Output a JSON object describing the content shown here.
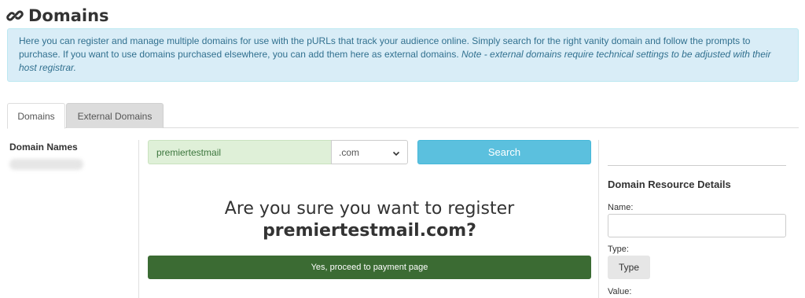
{
  "header": {
    "title": "Domains",
    "icon": "link-icon"
  },
  "info": {
    "text": "Here you can register and manage multiple domains for use with the pURLs that track your audience online. Simply search for the right vanity domain and follow the prompts to purchase. If you want to use domains purchased elsewhere, you can add them here as external domains.",
    "note": "Note - external domains require technical settings to be adjusted with their host registrar."
  },
  "tabs": [
    {
      "label": "Domains",
      "active": true
    },
    {
      "label": "External Domains",
      "active": false
    }
  ],
  "sidebar": {
    "heading": "Domain Names"
  },
  "search": {
    "value": "premiertestmail",
    "tld": ".com",
    "button_label": "Search"
  },
  "confirm": {
    "question": "Are you sure you want to register",
    "domain": "premiertestmail.com?",
    "button_label": "Yes, proceed to payment page"
  },
  "details": {
    "title": "Domain Resource Details",
    "name_label": "Name:",
    "type_label": "Type:",
    "type_button": "Type",
    "value_label": "Value:"
  },
  "colors": {
    "info_bg": "#d9edf7",
    "search_button": "#5bc0de",
    "proceed_button": "#3b6b33",
    "input_success_bg": "#dff0d8"
  }
}
